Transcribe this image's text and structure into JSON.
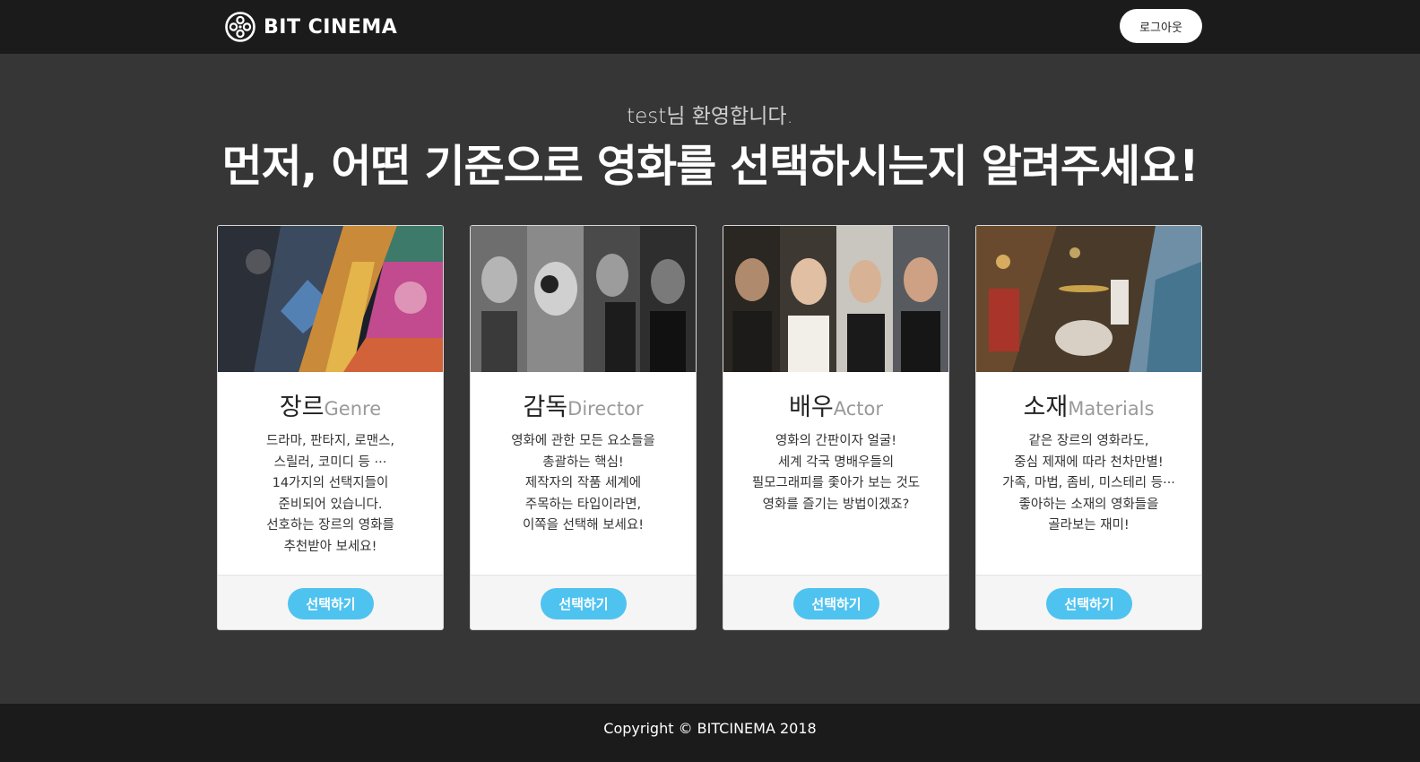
{
  "navbar": {
    "brand": "BIT CINEMA",
    "logout_label": "로그아웃"
  },
  "hero": {
    "username": "test",
    "welcome_suffix": "님 환영합니다.",
    "headline": "먼저, 어떤 기준으로 영화를 선택하시는지 알려주세요!"
  },
  "cards": [
    {
      "title_ko": "장르",
      "title_en": "Genre",
      "desc": [
        "드라마, 판타지, 로맨스,",
        "스릴러, 코미디 등 ···",
        "14가지의 선택지들이",
        "준비되어 있습니다.",
        "선호하는 장르의 영화를",
        "추천받아 보세요!"
      ],
      "button": "선택하기"
    },
    {
      "title_ko": "감독",
      "title_en": "Director",
      "desc": [
        "영화에 관한 모든 요소들을",
        "총괄하는 핵심!",
        "제작자의 작품 세계에",
        "주목하는 타입이라면,",
        "이쪽을 선택해 보세요!"
      ],
      "button": "선택하기"
    },
    {
      "title_ko": "배우",
      "title_en": "Actor",
      "desc": [
        "영화의 간판이자 얼굴!",
        "세계 각국 명배우들의",
        "필모그래피를 좇아가 보는 것도",
        "영화를 즐기는 방법이겠죠?"
      ],
      "button": "선택하기"
    },
    {
      "title_ko": "소재",
      "title_en": "Materials",
      "desc": [
        "같은 장르의 영화라도,",
        "중심 제재에 따라 천차만별!",
        "가족, 마법, 좀비, 미스테리 등···",
        "좋아하는 소재의 영화들을",
        "골라보는 재미!"
      ],
      "button": "선택하기"
    }
  ],
  "footer": {
    "copyright": "Copyright © BITCINEMA 2018"
  },
  "colors": {
    "navbar_bg": "#1b1b1b",
    "page_bg": "#363636",
    "accent_button": "#4fc3f0"
  },
  "icons": {
    "brand_logo": "film-reel-icon"
  }
}
